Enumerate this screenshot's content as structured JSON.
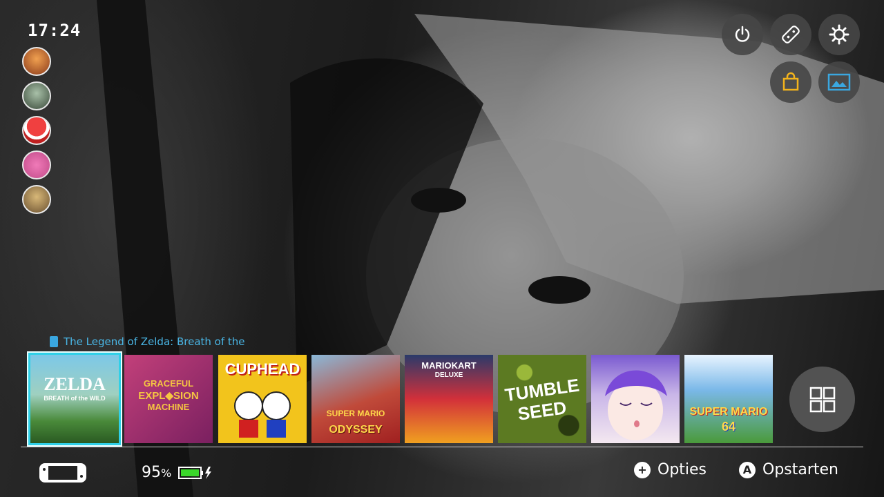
{
  "status": {
    "time": "17:24",
    "battery_percent": "95",
    "battery_unit": "%"
  },
  "users": [
    {
      "name": "user-1",
      "color": "#d07a3a"
    },
    {
      "name": "user-2",
      "color": "#6a8a6a"
    },
    {
      "name": "user-3",
      "color": "#d23a3a"
    },
    {
      "name": "user-4",
      "color": "#e66aa8"
    },
    {
      "name": "user-5",
      "color": "#a08a60"
    }
  ],
  "top_buttons": [
    "power-icon",
    "controller-icon",
    "settings-icon",
    "eshop-icon",
    "album-icon"
  ],
  "selected_game_title": "The Legend of Zelda: Breath of the",
  "games": [
    {
      "name": "zelda",
      "label": "ZELDA",
      "sub": "BREATH of the WILD",
      "bg": "#5c9fb8",
      "fg": "#ffffff"
    },
    {
      "name": "graceful-explosion-machine",
      "label": "GRACEFUL",
      "label2": "EXPL◆SION",
      "label3": "MACHINE",
      "bg": "#a0306e",
      "fg": "#f5c542"
    },
    {
      "name": "cuphead",
      "label": "CUPHEAD",
      "bg": "#f2c41c",
      "fg": "#ffffff"
    },
    {
      "name": "super-mario-odyssey",
      "label": "SUPER MARIO",
      "sub": "ODYSSEY",
      "bg": "#b82a2a",
      "fg": "#ffd84a"
    },
    {
      "name": "mario-kart-8-deluxe",
      "label": "MARIOKART",
      "sub": "DELUXE",
      "bg": "#d2303a",
      "fg": "#ffffff"
    },
    {
      "name": "tumbleseed",
      "label": "TUMBLE",
      "sub": "SEED",
      "bg": "#5c7a22",
      "fg": "#ffffff"
    },
    {
      "name": "anime-game",
      "label": "",
      "bg": "#c9b6e8",
      "fg": "#ffffff"
    },
    {
      "name": "super-mario-64",
      "label": "SUPER MARIO",
      "sub": "64",
      "bg": "#7ab8e8",
      "fg": "#ffd84a"
    }
  ],
  "footer": {
    "options_label": "Opties",
    "options_glyph": "+",
    "start_label": "Opstarten",
    "start_glyph": "A"
  }
}
